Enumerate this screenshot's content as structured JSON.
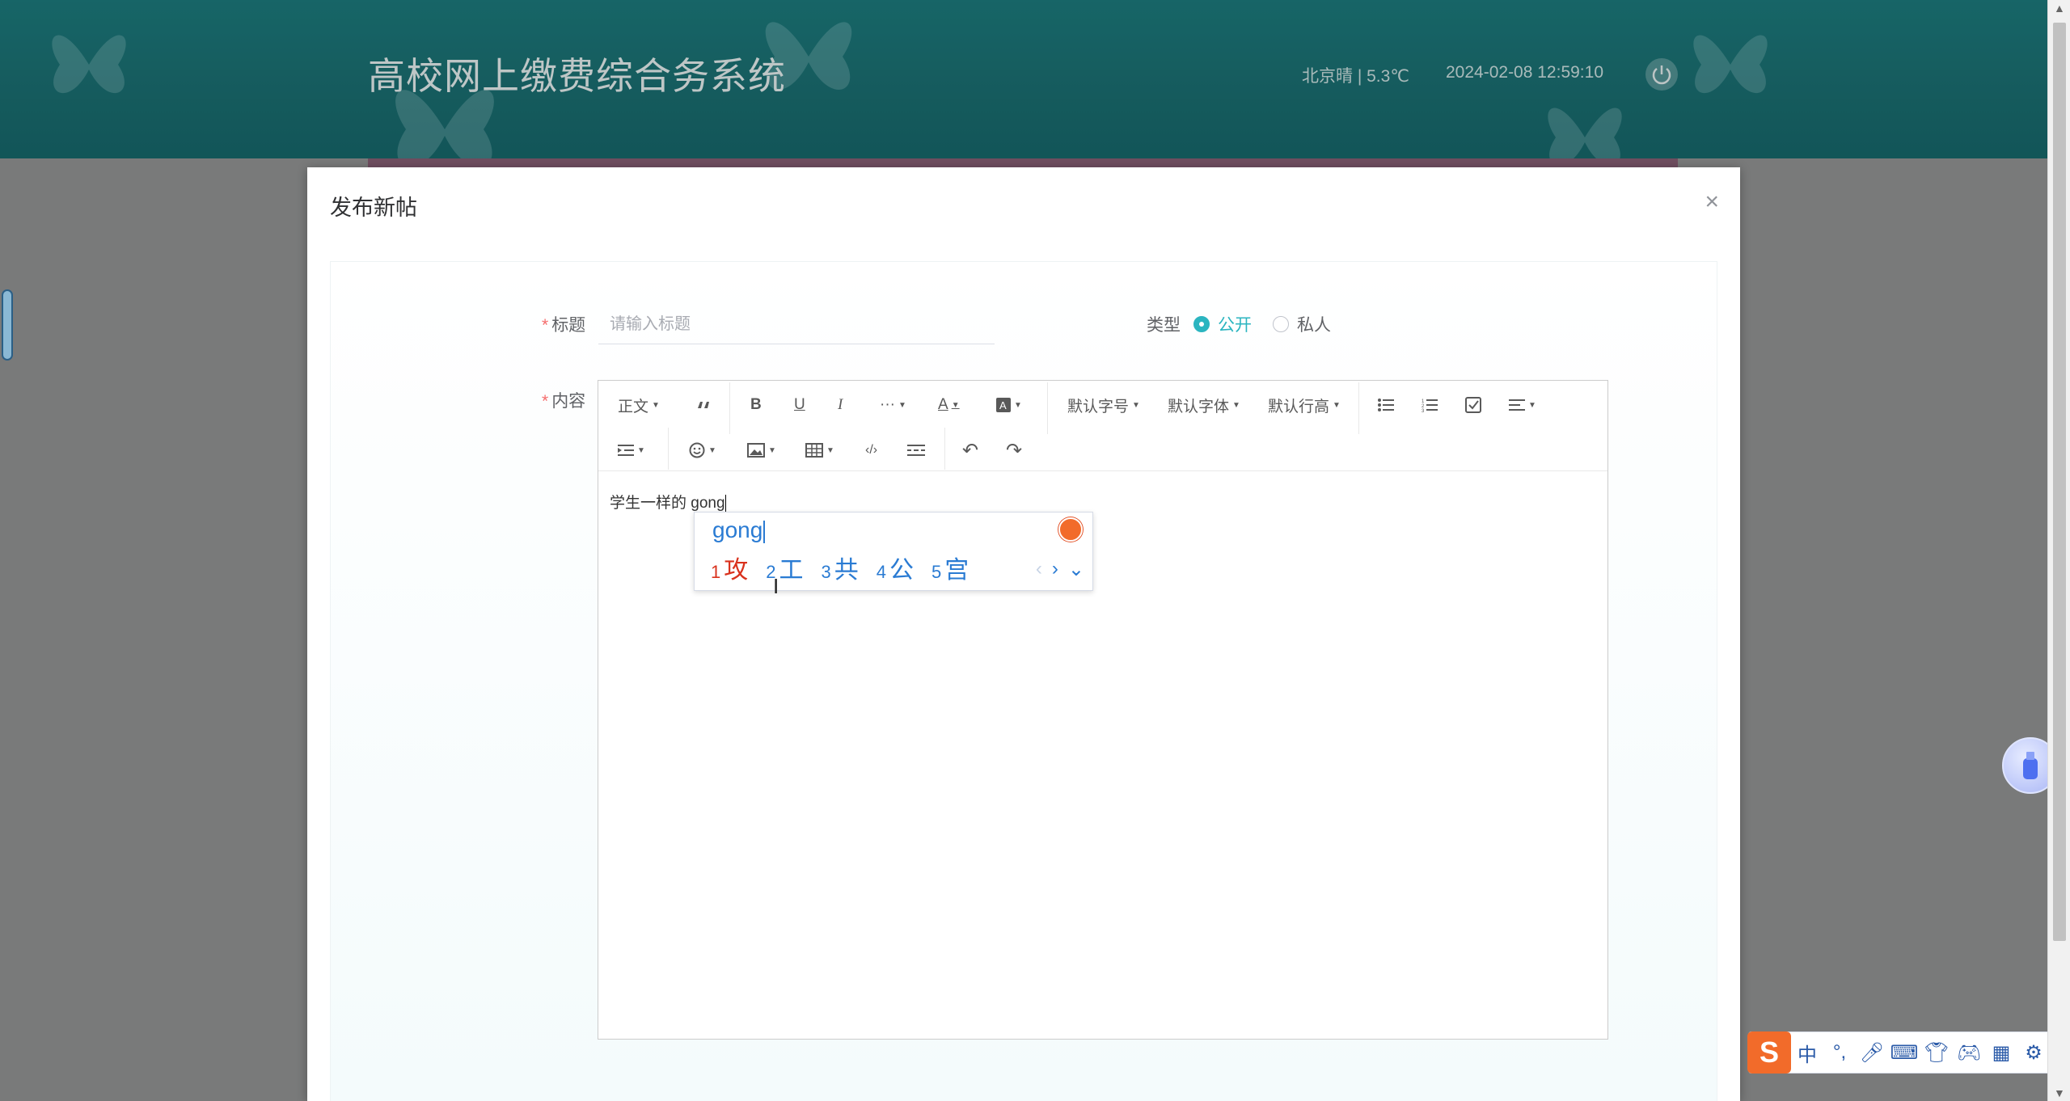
{
  "header": {
    "title": "高校网上缴费综合务系统",
    "weather": "北京晴 | 5.3℃",
    "datetime": "2024-02-08   12:59:10"
  },
  "dialog": {
    "title": "发布新帖",
    "close": "×",
    "form": {
      "title_label": "标题",
      "title_placeholder": "请输入标题",
      "type_label": "类型",
      "type_options": [
        "公开",
        "私人"
      ],
      "type_selected": "公开",
      "content_label": "内容",
      "required_mark": "*"
    },
    "toolbar": {
      "paragraph": "正文",
      "more": "···",
      "font_size": "默认字号",
      "font_family": "默认字体",
      "line_height": "默认行高"
    },
    "editor_text": "学生一样的 gong"
  },
  "ime_popup": {
    "pinyin": "gong",
    "candidates": [
      {
        "n": "1",
        "text": "攻"
      },
      {
        "n": "2",
        "text": "工"
      },
      {
        "n": "3",
        "text": "共"
      },
      {
        "n": "4",
        "text": "公"
      },
      {
        "n": "5",
        "text": "宫"
      }
    ],
    "prev": "‹",
    "next": "›",
    "expand": "⌄"
  },
  "ime_bar": {
    "logo": "S",
    "mode": "中",
    "punct": "°,"
  }
}
